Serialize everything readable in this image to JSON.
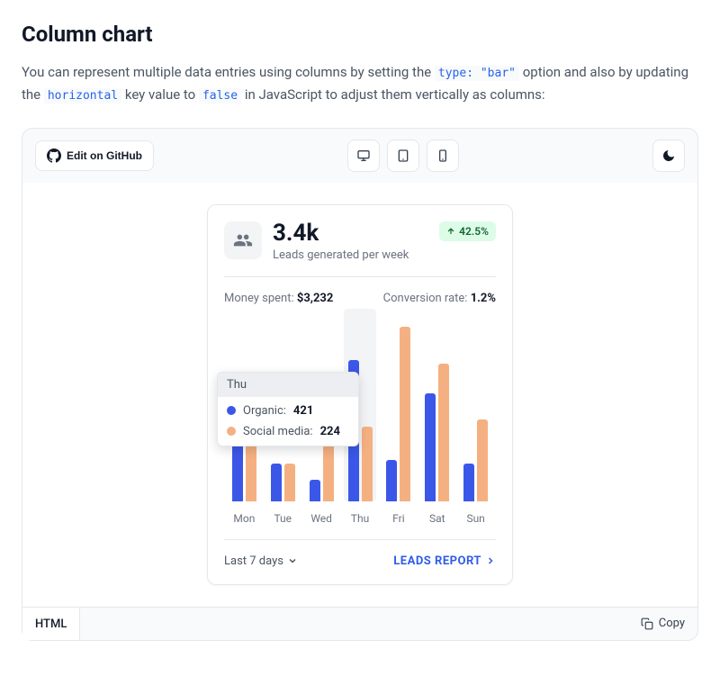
{
  "page": {
    "title": "Column chart",
    "desc_pre": "You can represent multiple data entries using columns by setting the ",
    "code1": "type: \"bar\"",
    "desc_mid": " option and also by updating the ",
    "code2": "horizontal",
    "desc_mid2": " key value to ",
    "code3": "false",
    "desc_post": " in JavaScript to adjust them vertically as columns:"
  },
  "toolbar": {
    "edit_label": "Edit on GitHub"
  },
  "card": {
    "big_value": "3.4k",
    "subtitle": "Leads generated per week",
    "badge_value": "42.5%",
    "money_label": "Money spent:",
    "money_value": "$3,232",
    "conv_label": "Conversion rate:",
    "conv_value": "1.2%",
    "dropdown_label": "Last 7 days",
    "report_label": "LEADS REPORT"
  },
  "tooltip": {
    "title": "Thu",
    "rows": [
      {
        "label": "Organic:",
        "value": "421"
      },
      {
        "label": "Social media:",
        "value": "224"
      }
    ]
  },
  "code_section": {
    "tab": "HTML",
    "copy": "Copy"
  },
  "chart_data": {
    "type": "bar",
    "title": "Leads generated per week",
    "categories": [
      "Mon",
      "Tue",
      "Wed",
      "Thu",
      "Fri",
      "Sat",
      "Sun"
    ],
    "series": [
      {
        "name": "Organic",
        "color": "#3b57e8",
        "values": [
          232,
          113,
          63,
          421,
          122,
          323,
          111
        ]
      },
      {
        "name": "Social media",
        "color": "#f5b081",
        "values": [
          232,
          113,
          341,
          224,
          522,
          411,
          243
        ]
      }
    ],
    "xlabel": "",
    "ylabel": "",
    "ylim": [
      0,
      550
    ]
  }
}
